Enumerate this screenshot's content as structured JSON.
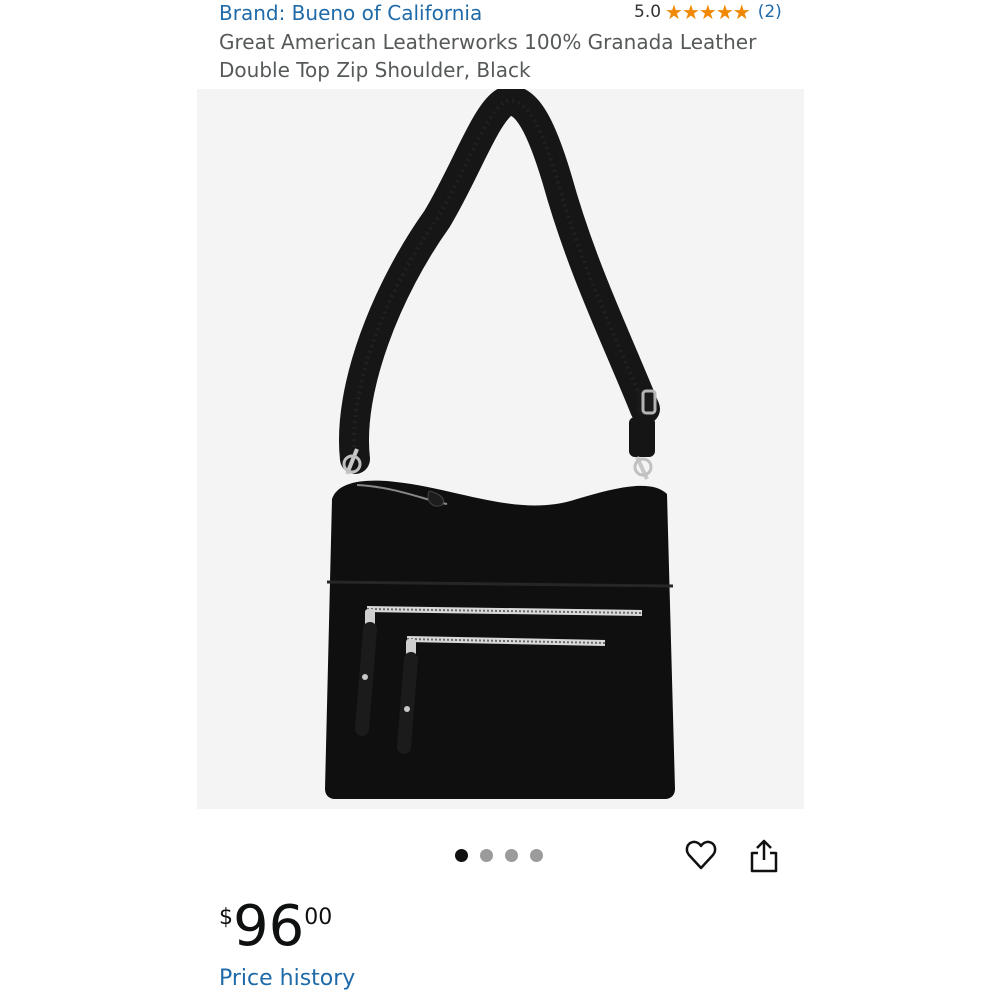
{
  "product": {
    "brand_label": "Brand: Bueno of California",
    "title": "Great American Leatherworks 100% Granada Leather Double Top Zip Shoulder, Black",
    "rating": {
      "score": "5.0",
      "stars": 5,
      "count": "(2)"
    },
    "price": {
      "currency": "$",
      "whole": "96",
      "fraction": "00"
    },
    "price_history_label": "Price history"
  },
  "gallery": {
    "image": "black-leather-shoulder-bag",
    "total_images": 4,
    "active_index": 0
  },
  "colors": {
    "link": "#1f6aa8",
    "star": "#f08804",
    "image_background": "#f4f4f4"
  },
  "icons": [
    "heart-icon",
    "share-icon",
    "star-icon"
  ]
}
